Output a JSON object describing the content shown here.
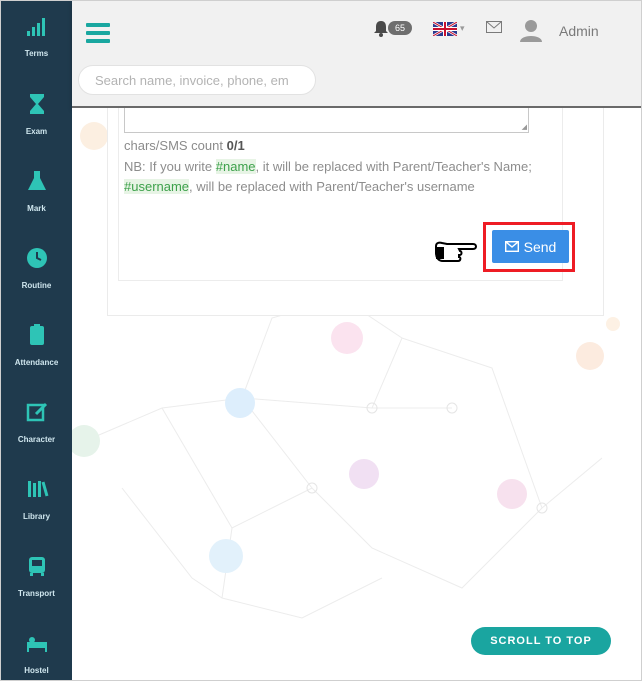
{
  "sidebar": {
    "items": [
      {
        "label": "Terms",
        "icon": "signal-bars-icon"
      },
      {
        "label": "Exam",
        "icon": "hourglass-icon"
      },
      {
        "label": "Mark",
        "icon": "flask-icon"
      },
      {
        "label": "Routine",
        "icon": "clock-icon"
      },
      {
        "label": "Attendance",
        "icon": "clipboard-icon"
      },
      {
        "label": "Character",
        "icon": "edit-icon"
      },
      {
        "label": "Library",
        "icon": "books-icon"
      },
      {
        "label": "Transport",
        "icon": "bus-icon"
      },
      {
        "label": "Hostel",
        "icon": "bed-icon"
      }
    ]
  },
  "header": {
    "search_placeholder": "Search name, invoice, phone, em",
    "notification_count": "65",
    "user_name": "Admin"
  },
  "form": {
    "count_label": "chars/SMS count",
    "count_value": "0/1",
    "nb_prefix": "NB: If you write",
    "tag_name": "#name",
    "nb_middle": ", it will be replaced with Parent/Teacher's Name;",
    "tag_username": "#username",
    "nb_suffix": ", will be replaced with Parent/Teacher's username",
    "send_label": "Send"
  },
  "scroll_top_label": "SCROLL TO TOP",
  "colors": {
    "sidebar_bg": "#1f3a4d",
    "accent_teal": "#19a7a0",
    "send_blue": "#3a8ee6",
    "highlight_red": "#ee1c24"
  }
}
